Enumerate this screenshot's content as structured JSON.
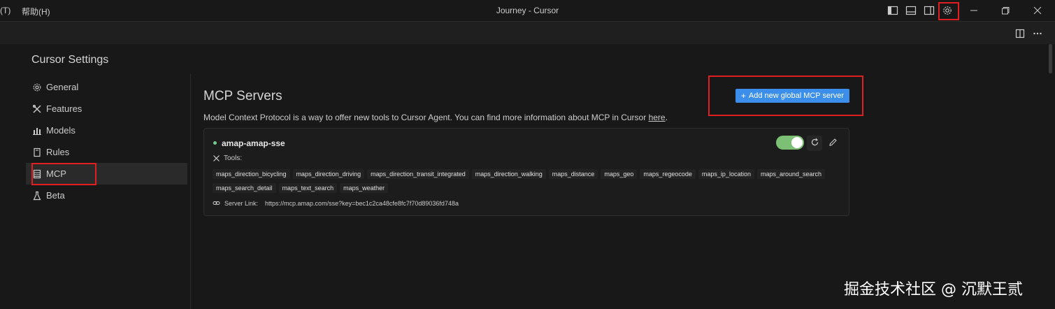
{
  "titlebar": {
    "menu_partial": "(T)",
    "menu_help": "帮助(H)",
    "title": "Journey - Cursor"
  },
  "settings": {
    "title": "Cursor Settings",
    "sidebar": [
      {
        "label": "General",
        "icon": "gear-icon"
      },
      {
        "label": "Features",
        "icon": "tools-icon"
      },
      {
        "label": "Models",
        "icon": "bar-chart-icon"
      },
      {
        "label": "Rules",
        "icon": "book-icon"
      },
      {
        "label": "MCP",
        "icon": "server-icon",
        "active": true
      },
      {
        "label": "Beta",
        "icon": "flask-icon"
      }
    ]
  },
  "mcp": {
    "title": "MCP Servers",
    "description": "Model Context Protocol is a way to offer new tools to Cursor Agent. You can find more information about MCP in Cursor ",
    "description_link": "here",
    "description_end": ".",
    "add_button_icon": "+",
    "add_button_label": "Add new global MCP server",
    "server": {
      "name": "amap-amap-sse",
      "status": "connected",
      "enabled": true,
      "tools_label": "Tools:",
      "tools": [
        "maps_direction_bicycling",
        "maps_direction_driving",
        "maps_direction_transit_integrated",
        "maps_direction_walking",
        "maps_distance",
        "maps_geo",
        "maps_regeocode",
        "maps_ip_location",
        "maps_around_search",
        "maps_search_detail",
        "maps_text_search",
        "maps_weather"
      ],
      "link_label": "Server Link:",
      "link_url": "https://mcp.amap.com/sse?key=bec1c2ca48cfe8fc7f70d89036fd748a"
    }
  },
  "watermark": "掘金技术社区 @ 沉默王贰",
  "colors": {
    "accent": "#3b8eea",
    "toggle_on": "#7bc075",
    "status_ok": "#73c991",
    "highlight_box": "#e02020"
  }
}
